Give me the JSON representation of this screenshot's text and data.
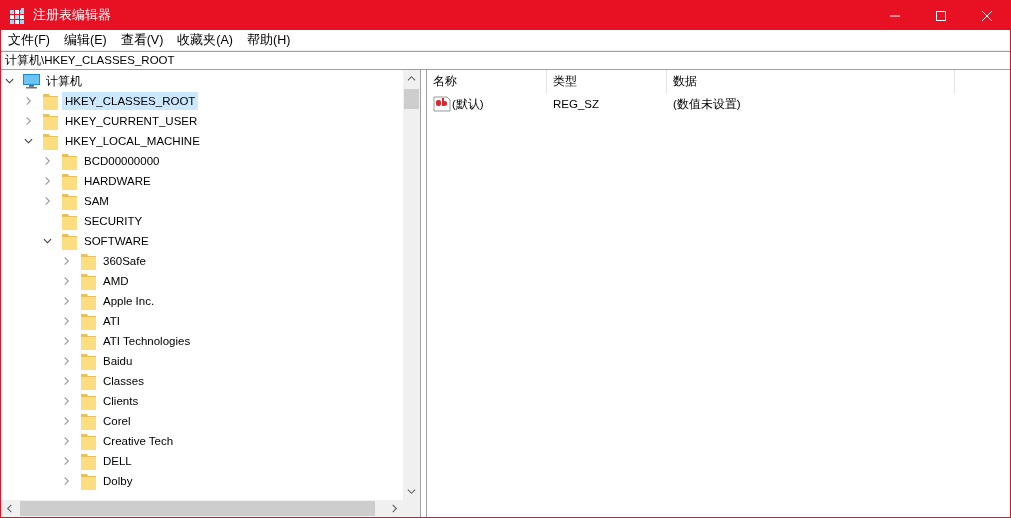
{
  "window": {
    "title": "注册表编辑器"
  },
  "menu": [
    "文件(F)",
    "编辑(E)",
    "查看(V)",
    "收藏夹(A)",
    "帮助(H)"
  ],
  "address": {
    "value": "计算机\\HKEY_CLASSES_ROOT"
  },
  "tree": [
    {
      "label": "计算机",
      "kind": "computer",
      "expanded": true,
      "selected": false,
      "children": [
        {
          "label": "HKEY_CLASSES_ROOT",
          "kind": "folder",
          "expanded": false,
          "selected": true
        },
        {
          "label": "HKEY_CURRENT_USER",
          "kind": "folder",
          "expanded": false,
          "selected": false
        },
        {
          "label": "HKEY_LOCAL_MACHINE",
          "kind": "folder",
          "expanded": true,
          "selected": false,
          "children": [
            {
              "label": "BCD00000000",
              "kind": "folder",
              "expanded": false,
              "selected": false
            },
            {
              "label": "HARDWARE",
              "kind": "folder",
              "expanded": false,
              "selected": false
            },
            {
              "label": "SAM",
              "kind": "folder",
              "expanded": false,
              "selected": false
            },
            {
              "label": "SECURITY",
              "kind": "leaf",
              "selected": false
            },
            {
              "label": "SOFTWARE",
              "kind": "folder",
              "expanded": true,
              "selected": false,
              "children": [
                {
                  "label": "360Safe",
                  "kind": "folder",
                  "expanded": false,
                  "selected": false
                },
                {
                  "label": "AMD",
                  "kind": "folder",
                  "expanded": false,
                  "selected": false
                },
                {
                  "label": "Apple Inc.",
                  "kind": "folder",
                  "expanded": false,
                  "selected": false
                },
                {
                  "label": "ATI",
                  "kind": "folder",
                  "expanded": false,
                  "selected": false
                },
                {
                  "label": "ATI Technologies",
                  "kind": "folder",
                  "expanded": false,
                  "selected": false
                },
                {
                  "label": "Baidu",
                  "kind": "folder",
                  "expanded": false,
                  "selected": false
                },
                {
                  "label": "Classes",
                  "kind": "folder",
                  "expanded": false,
                  "selected": false
                },
                {
                  "label": "Clients",
                  "kind": "folder",
                  "expanded": false,
                  "selected": false
                },
                {
                  "label": "Corel",
                  "kind": "folder",
                  "expanded": false,
                  "selected": false
                },
                {
                  "label": "Creative Tech",
                  "kind": "folder",
                  "expanded": false,
                  "selected": false
                },
                {
                  "label": "DELL",
                  "kind": "folder",
                  "expanded": false,
                  "selected": false
                },
                {
                  "label": "Dolby",
                  "kind": "folder",
                  "expanded": false,
                  "selected": false
                }
              ]
            }
          ]
        }
      ]
    }
  ],
  "table": {
    "columns": [
      "名称",
      "类型",
      "数据"
    ],
    "rows": [
      {
        "name": "(默认)",
        "type": "REG_SZ",
        "data": "(数值未设置)"
      }
    ]
  }
}
